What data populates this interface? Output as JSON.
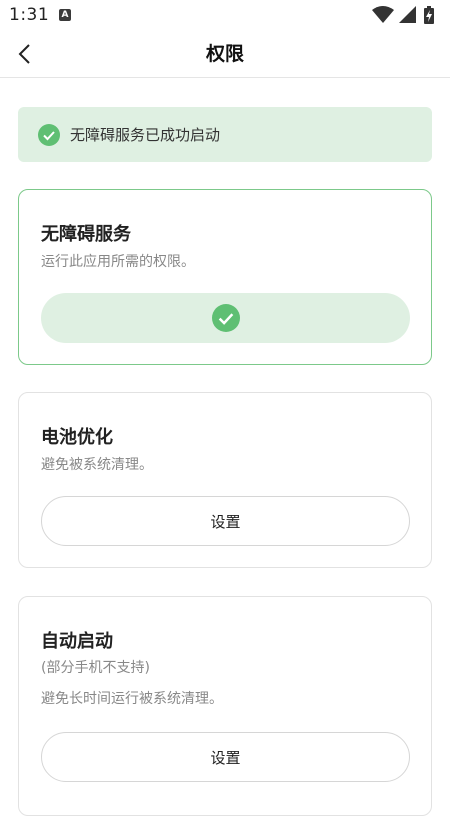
{
  "status_bar": {
    "time": "1:31",
    "notification_badge": "A",
    "icons": [
      "wifi-icon",
      "cellular-signal-icon",
      "battery-charging-icon"
    ]
  },
  "header": {
    "title": "权限",
    "back_icon": "chevron-left-icon"
  },
  "banner": {
    "text": "无障碍服务已成功启动",
    "icon": "check-circle-icon"
  },
  "cards": [
    {
      "title": "无障碍服务",
      "description": "运行此应用所需的权限。",
      "state": "granted",
      "button_icon": "check-circle-icon"
    },
    {
      "title": "电池优化",
      "description": "避免被系统清理。",
      "button_label": "设置"
    },
    {
      "title": "自动启动",
      "note": "(部分手机不支持)",
      "description": "避免长时间运行被系统清理。",
      "button_label": "设置"
    }
  ],
  "colors": {
    "accent_green": "#5fbf73",
    "success_bg": "#dff0e2",
    "active_border": "#7cc98a"
  }
}
